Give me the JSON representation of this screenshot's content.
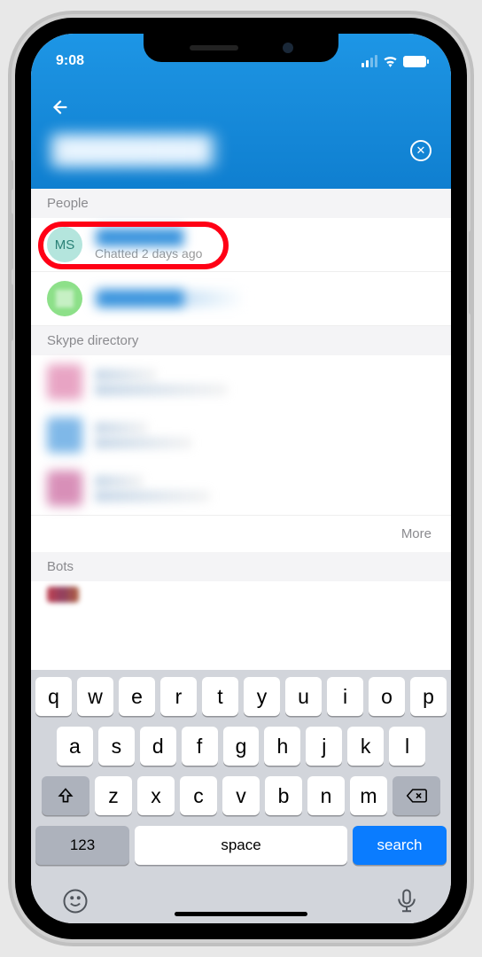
{
  "status": {
    "time": "9:08"
  },
  "search": {
    "query": "████████",
    "clear_icon": "✕"
  },
  "sections": {
    "people": {
      "title": "People",
      "items": [
        {
          "initials": "MS",
          "name": "████████",
          "subtitle": "Chatted 2 days ago"
        },
        {
          "initials": "",
          "name": "████████",
          "subtitle": ""
        }
      ]
    },
    "directory": {
      "title": "Skype directory",
      "more": "More"
    },
    "bots": {
      "title": "Bots"
    }
  },
  "keyboard": {
    "row1": [
      "q",
      "w",
      "e",
      "r",
      "t",
      "y",
      "u",
      "i",
      "o",
      "p"
    ],
    "row2": [
      "a",
      "s",
      "d",
      "f",
      "g",
      "h",
      "j",
      "k",
      "l"
    ],
    "row3": [
      "z",
      "x",
      "c",
      "v",
      "b",
      "n",
      "m"
    ],
    "num": "123",
    "space": "space",
    "action": "search"
  }
}
